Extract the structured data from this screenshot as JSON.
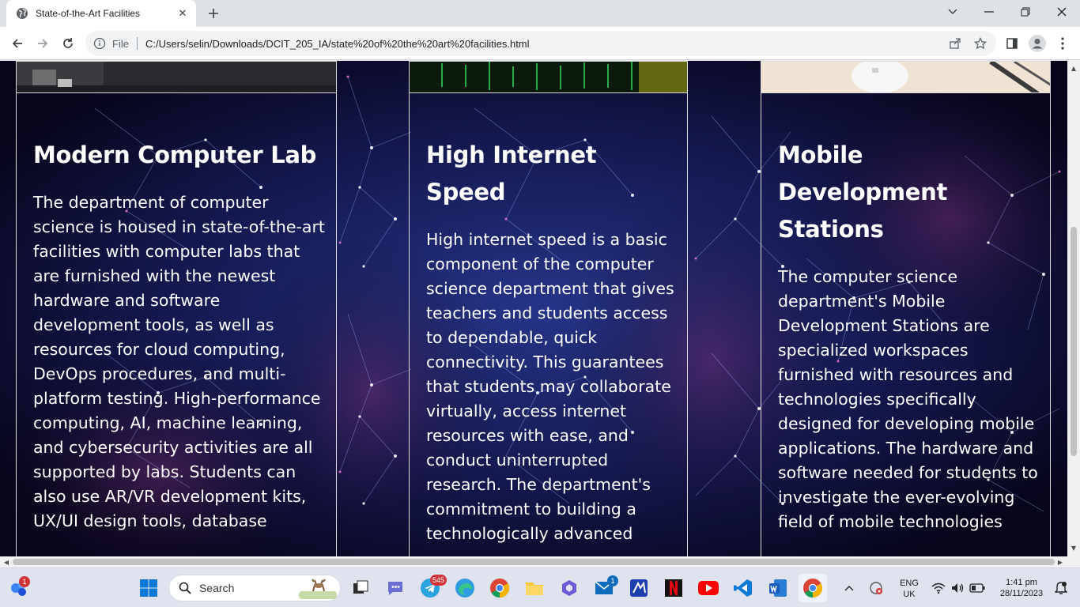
{
  "browser": {
    "tab_title": "State-of-the-Art Facilities",
    "tab_close": "✕",
    "new_tab": "+",
    "scheme": "File",
    "url": "C:/Users/selin/Downloads/DCIT_205_IA/state%20of%20the%20art%20facilities.html"
  },
  "cards": [
    {
      "title": "Modern Computer Lab",
      "body": "The department of computer science is housed in state-of-the-art facilities with computer labs that are furnished with the newest hardware and software development tools, as well as resources for cloud computing, DevOps procedures, and multi-platform testing. High-performance computing, AI, machine learning, and cybersecurity activities are all supported by labs. Students can also use AR/VR development kits, UX/UI design tools, database"
    },
    {
      "title": "High Internet Speed",
      "body": "High internet speed is a basic component of the computer science department that gives teachers and students access to dependable, quick connectivity. This guarantees that students may collaborate virtually, access internet resources with ease, and conduct uninterrupted research. The department's commitment to building a technologically advanced"
    },
    {
      "title": "Mobile Development Stations",
      "body": "The computer science department's Mobile Development Stations are specialized workspaces furnished with resources and technologies specifically designed for developing mobile applications. The hardware and software needed for students to investigate the ever-evolving field of mobile technologies"
    }
  ],
  "taskbar": {
    "search_label": "Search",
    "badges": {
      "widgets": "1",
      "telegram": "545",
      "mail": "1"
    },
    "language": "ENG",
    "region": "UK",
    "time": "1:41 pm",
    "date": "28/11/2023"
  },
  "colors": {
    "accent_blue": "#1a73e8",
    "page_bg": "#08061a",
    "card_border": "#dcdcdc"
  }
}
